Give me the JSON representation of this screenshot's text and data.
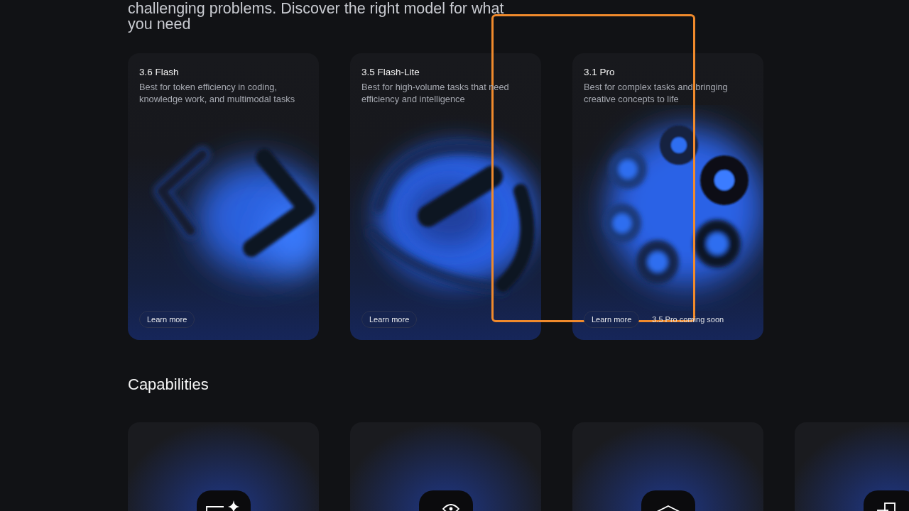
{
  "intro": {
    "text": "challenging problems. Discover the right model for what you need"
  },
  "models": [
    {
      "name": "3.6 Flash",
      "description": "Best for token efficiency in coding, knowledge work, and multimodal tasks",
      "button": "Learn more"
    },
    {
      "name": "3.5 Flash-Lite",
      "description": "Best for high-volume tasks that need efficiency and intelligence",
      "button": "Learn more"
    },
    {
      "name": "3.1 Pro",
      "description": "Best for complex tasks and bringing creative concepts to life",
      "button": "Learn more",
      "note": "3.5 Pro coming soon"
    }
  ],
  "capabilities": {
    "title": "Capabilities"
  },
  "annotation": {
    "kind": "outline"
  }
}
